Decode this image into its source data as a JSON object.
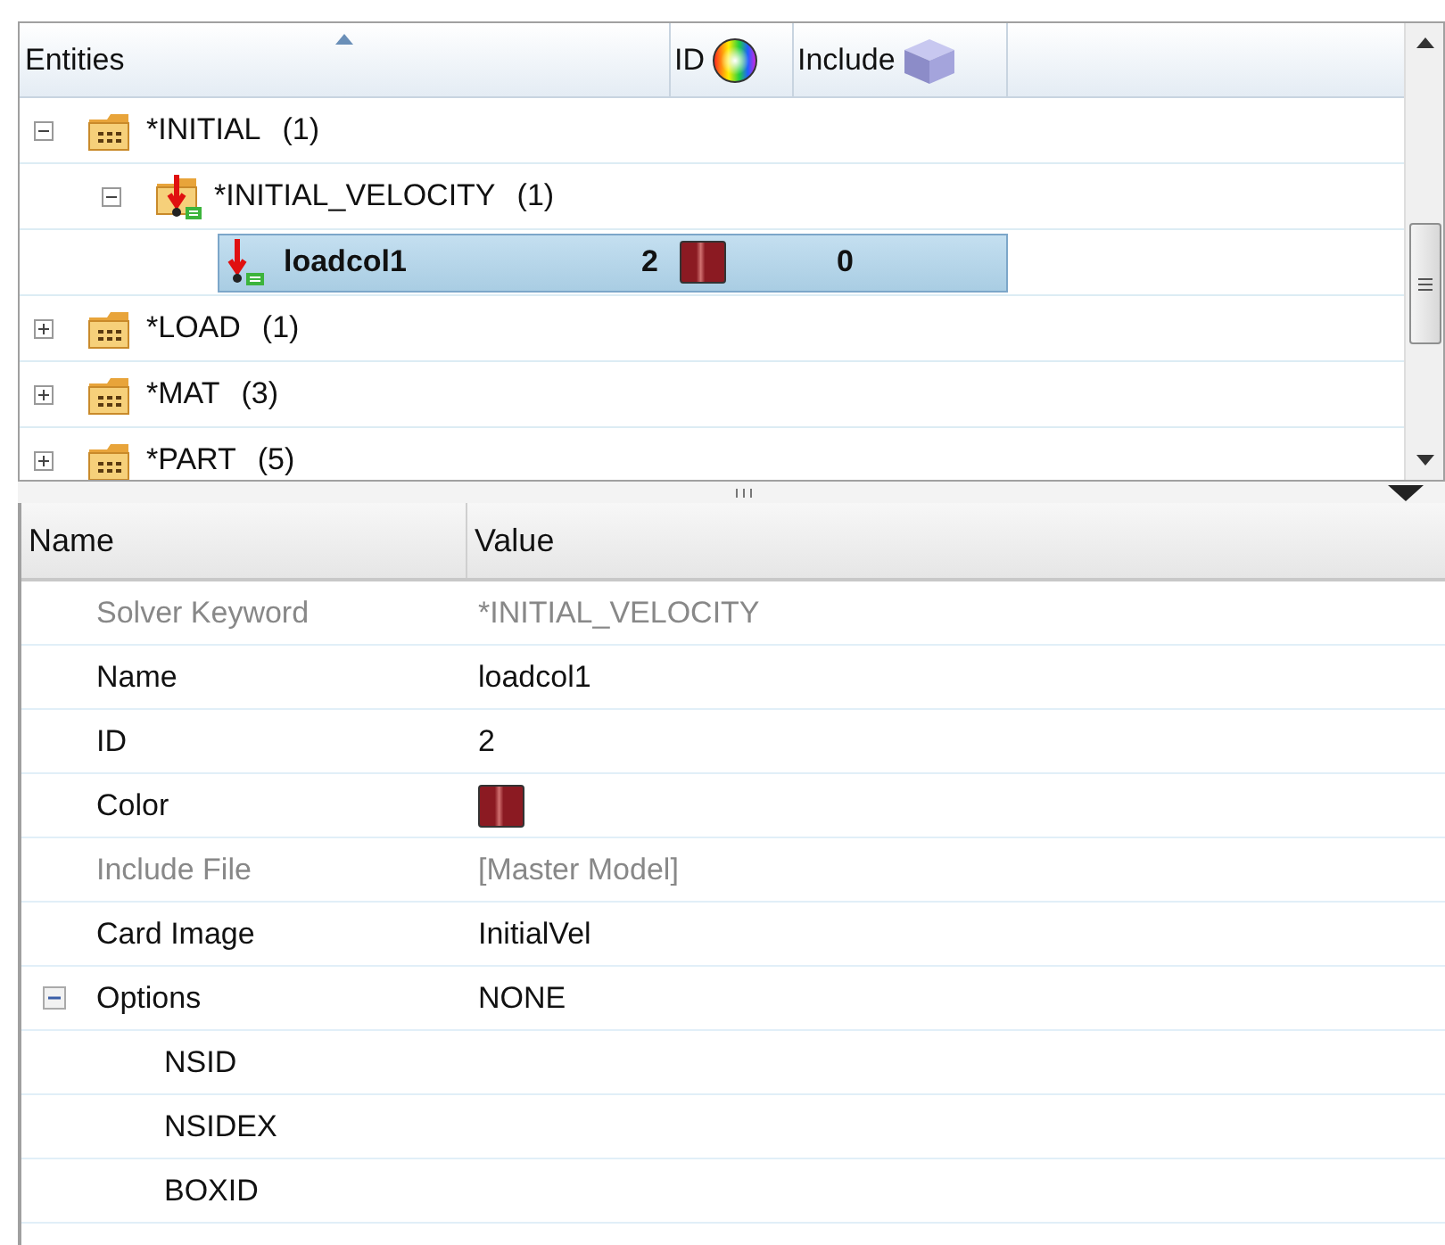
{
  "tree": {
    "columns": [
      {
        "label": "Entities",
        "sorted": true
      },
      {
        "label": "ID"
      },
      {
        "label": "Include"
      }
    ],
    "items": [
      {
        "label": "*INITIAL",
        "count": "(1)",
        "kind": "folder",
        "expanded": true,
        "selected": false,
        "children": [
          {
            "label": "*INITIAL_VELOCITY",
            "count": "(1)",
            "kind": "load-folder",
            "expanded": true,
            "selected": false,
            "children": [
              {
                "label": "loadcol1",
                "kind": "load",
                "selected": true,
                "id": "2",
                "color": "#8b1a22",
                "include": "0"
              }
            ]
          }
        ]
      },
      {
        "label": "*LOAD",
        "count": "(1)",
        "kind": "folder",
        "expanded": false,
        "selected": false
      },
      {
        "label": "*MAT",
        "count": "(3)",
        "kind": "folder",
        "expanded": false,
        "selected": false
      },
      {
        "label": "*PART",
        "count": "(5)",
        "kind": "folder",
        "expanded": false,
        "selected": false
      }
    ]
  },
  "properties": {
    "columns": [
      "Name",
      "Value"
    ],
    "rows": [
      {
        "name": "Solver Keyword",
        "value": "*INITIAL_VELOCITY",
        "kind": "text",
        "disabled": true
      },
      {
        "name": "Name",
        "value": "loadcol1",
        "kind": "text",
        "disabled": false
      },
      {
        "name": "ID",
        "value": "2",
        "kind": "text",
        "disabled": false
      },
      {
        "name": "Color",
        "kind": "color",
        "color": "#8b1a22",
        "disabled": false
      },
      {
        "name": "Include File",
        "value": "[Master Model]",
        "kind": "text",
        "disabled": true
      },
      {
        "name": "Card Image",
        "value": "InitialVel",
        "kind": "text",
        "disabled": false
      },
      {
        "name": "Options",
        "value": "NONE",
        "kind": "text",
        "disabled": false,
        "expanded": true,
        "children": [
          {
            "name": "NSID",
            "disabled": false
          },
          {
            "name": "NSIDEX",
            "disabled": false
          },
          {
            "name": "BOXID",
            "disabled": false
          }
        ]
      }
    ]
  }
}
